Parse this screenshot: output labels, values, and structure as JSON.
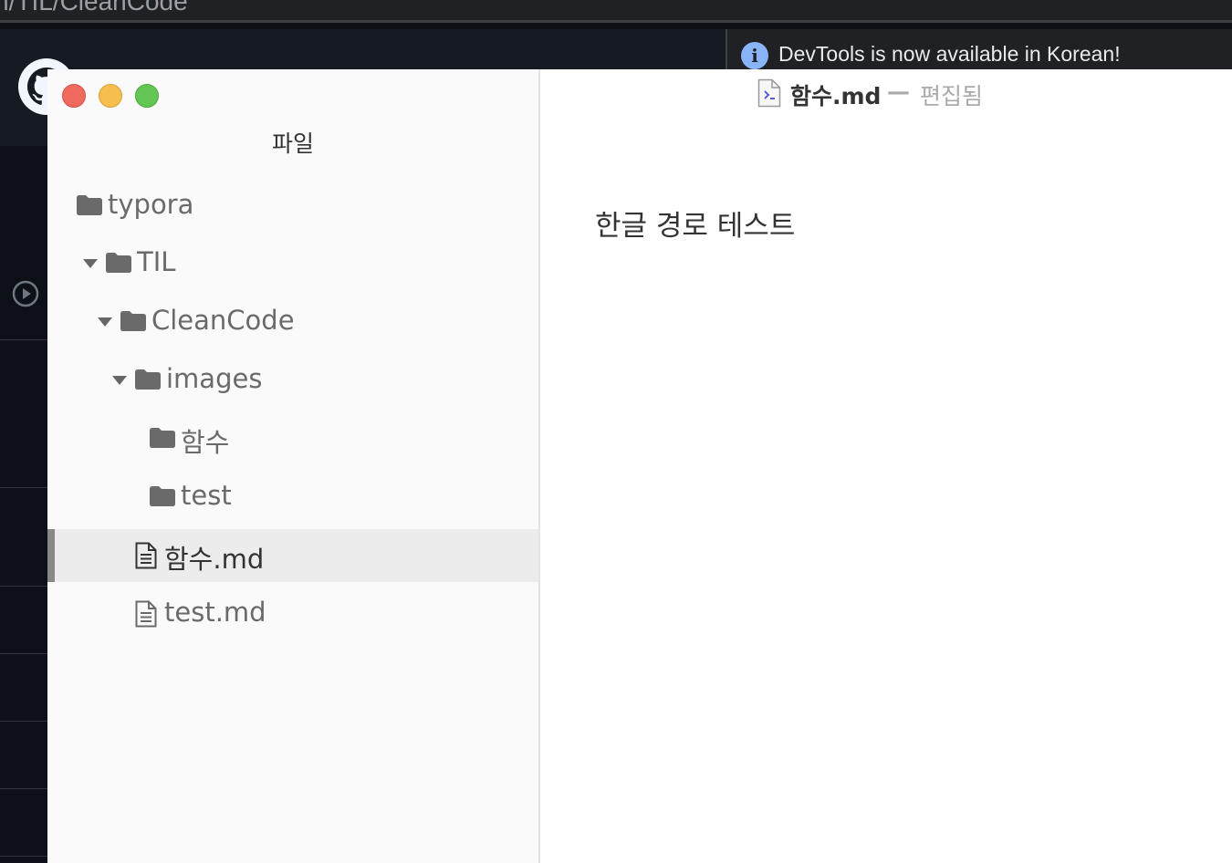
{
  "background": {
    "url_text": "n/TIL/CleanCode",
    "devtools_message": "DevTools is now available in Korean!"
  },
  "sidebar": {
    "title": "파일",
    "items": [
      {
        "label": "typora",
        "type": "folder",
        "expanded": false
      },
      {
        "label": "TIL",
        "type": "folder",
        "expanded": true
      },
      {
        "label": "CleanCode",
        "type": "folder",
        "expanded": true
      },
      {
        "label": "images",
        "type": "folder",
        "expanded": true
      },
      {
        "label": "함수",
        "type": "folder",
        "expanded": false
      },
      {
        "label": "test",
        "type": "folder",
        "expanded": false
      },
      {
        "label": "함수.md",
        "type": "file",
        "active": true
      },
      {
        "label": "test.md",
        "type": "file",
        "active": false
      }
    ]
  },
  "editor": {
    "file_name": "함수.md",
    "separator": "—",
    "status": "편집됨",
    "content": "한글 경로 테스트"
  },
  "colors": {
    "close": "#ee6a5f",
    "minimize": "#f5be4f",
    "maximize": "#62c655",
    "info": "#8ab4f8"
  }
}
